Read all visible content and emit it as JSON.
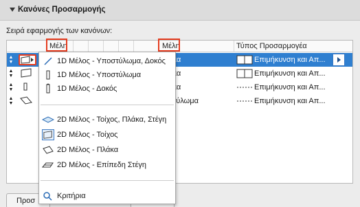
{
  "header": {
    "title": "Κανόνες Προσαρμογής"
  },
  "subtitle": "Σειρά εφαρμογής των κανόνων:",
  "table": {
    "columns": [
      "Μέλη",
      "Μέλη",
      "Τύπος Προσαρμογέα"
    ],
    "rows": [
      {
        "members2": "...άκα",
        "type": "Επιμήκυνση και Απ...",
        "selected": true
      },
      {
        "members2": "...ακα",
        "type": "Επιμήκυνση και Απ...",
        "selected": false
      },
      {
        "members2": "...ακα",
        "type": "Επιμήκυνση και Απ...",
        "selected": false
      },
      {
        "members2": "...στύλωμα",
        "type": "Επιμήκυνση και Απ...",
        "selected": false
      }
    ]
  },
  "menu": {
    "items_1d": [
      {
        "label": "1D Μέλος - Υποστύλωμα, Δοκός",
        "icon": "line-member-icon"
      },
      {
        "label": "1D Μέλος - Υποστύλωμα",
        "icon": "column-icon"
      },
      {
        "label": "1D Μέλος - Δοκός",
        "icon": "beam-icon"
      }
    ],
    "items_2d": [
      {
        "label": "2D Μέλος - Τοίχος, Πλάκα, Στέγη",
        "icon": "surface-member-icon"
      },
      {
        "label": "2D Μέλος - Τοίχος",
        "icon": "wall-icon"
      },
      {
        "label": "2D Μέλος - Πλάκα",
        "icon": "slab-icon"
      },
      {
        "label": "2D Μέλος - Επίπεδη Στέγη",
        "icon": "roof-icon"
      }
    ],
    "criteria": {
      "label": "Κριτήρια",
      "icon": "criteria-search-icon"
    }
  },
  "bottom_button": {
    "label": "Προσ"
  },
  "colors": {
    "selection": "#2f7fd0",
    "highlight": "#e53b1e",
    "accent": "#3a78c2"
  }
}
